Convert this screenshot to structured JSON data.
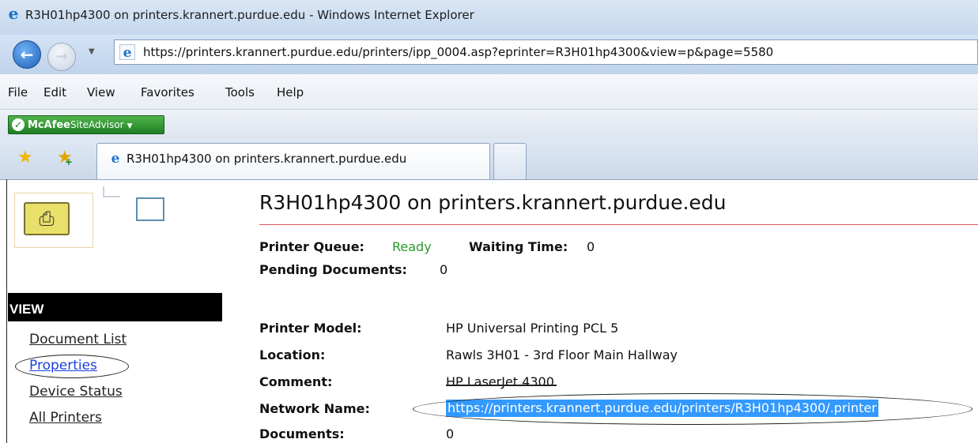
{
  "window": {
    "title": "R3H01hp4300 on printers.krannert.purdue.edu - Windows Internet Explorer"
  },
  "navigation": {
    "address": "https://printers.krannert.purdue.edu/printers/ipp_0004.asp?eprinter=R3H01hp4300&view=p&page=5580"
  },
  "menu": {
    "items": [
      "File",
      "Edit",
      "View",
      "Favorites",
      "Tools",
      "Help"
    ]
  },
  "toolbar": {
    "mcafee_brand": "McAfee",
    "mcafee_product": "SiteAdvisor"
  },
  "tabs": {
    "active_label": "R3H01hp4300 on printers.krannert.purdue.edu"
  },
  "sidebar": {
    "header": "VIEW",
    "links": [
      "Document List",
      "Properties",
      "Device Status",
      "All Printers"
    ],
    "active": "Properties"
  },
  "page": {
    "title": "R3H01hp4300 on printers.krannert.purdue.edu",
    "status": {
      "queue_label": "Printer Queue:",
      "queue_value": "Ready",
      "waiting_label": "Waiting Time:",
      "waiting_value": "0",
      "pending_label": "Pending Documents:",
      "pending_value": "0"
    },
    "properties": [
      {
        "label": "Printer Model:",
        "value": "HP Universal Printing PCL 5"
      },
      {
        "label": "Location:",
        "value": "Rawls 3H01 - 3rd Floor Main Hallway"
      },
      {
        "label": "Comment:",
        "value": "HP LaserJet 4300"
      },
      {
        "label": "Network Name:",
        "value": "https://printers.krannert.purdue.edu/printers/R3H01hp4300/.printer"
      },
      {
        "label": "Documents:",
        "value": "0"
      }
    ]
  },
  "colors": {
    "ready_status": "#2a9a2a",
    "selection_highlight": "#3399ff",
    "title_rule": "#dd5555",
    "active_link": "#1a3fe0"
  }
}
